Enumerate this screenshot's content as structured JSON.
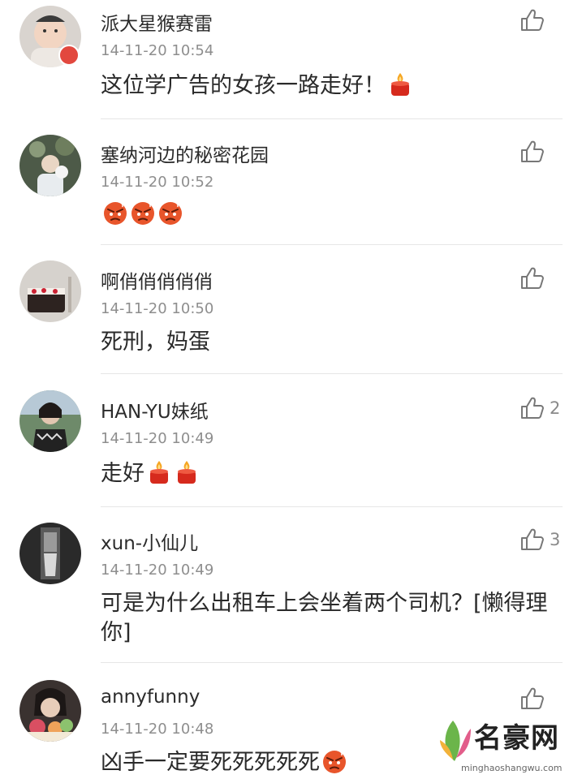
{
  "comments": [
    {
      "user": "派大星猴赛雷",
      "time": "14-11-20 10:54",
      "text": "这位学广告的女孩一路走好！",
      "likes": "",
      "emoji": "candle",
      "emoji_count": 1
    },
    {
      "user": "塞纳河边的秘密花园",
      "time": "14-11-20 10:52",
      "text": "",
      "likes": "",
      "emoji": "angry",
      "emoji_count": 3
    },
    {
      "user": "啊俏俏俏俏俏",
      "time": "14-11-20 10:50",
      "text": "死刑，妈蛋",
      "likes": "",
      "emoji": "",
      "emoji_count": 0
    },
    {
      "user": "HAN-YU妹纸",
      "time": "14-11-20 10:49",
      "text": "走好",
      "likes": "2",
      "emoji": "candle",
      "emoji_count": 2
    },
    {
      "user": "xun-小仙儿",
      "time": "14-11-20 10:49",
      "text": "可是为什么出租车上会坐着两个司机？[懒得理你]",
      "likes": "3",
      "emoji": "",
      "emoji_count": 0
    },
    {
      "user": "annyfunny",
      "time": "14-11-20 10:48",
      "text": "凶手一定要死死死死死",
      "likes": "",
      "emoji": "angry",
      "emoji_count": 1
    }
  ],
  "icons": {
    "like": "thumbs-up-icon",
    "candle": "candle-emoji",
    "angry": "angry-face-emoji"
  },
  "colors": {
    "text": "#2a2a2a",
    "meta": "#8e8e8e",
    "divider": "#e6e6e6",
    "angry": "#e8552b",
    "candle": "#d62a1d"
  },
  "watermark": {
    "brand": "名豪网",
    "url": "minghaoshangwu.com"
  }
}
